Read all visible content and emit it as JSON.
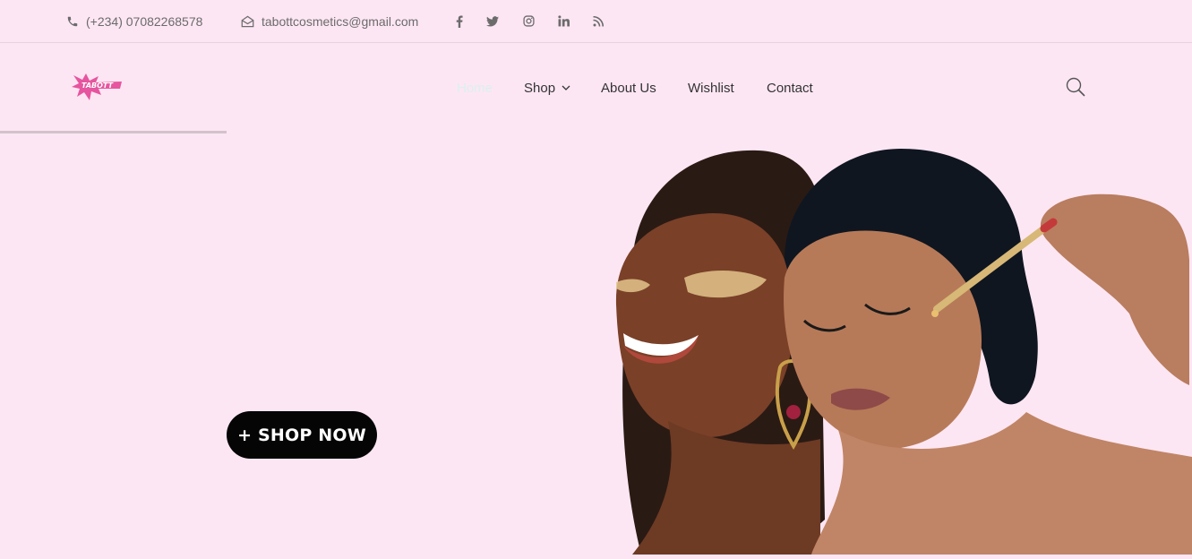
{
  "topbar": {
    "phone": "(+234) 07082268578",
    "email": "tabottcosmetics@gmail.com",
    "social": [
      {
        "icon": "facebook-icon",
        "glyph": "f"
      },
      {
        "icon": "twitter-icon",
        "glyph": "t"
      },
      {
        "icon": "instagram-icon",
        "glyph": "ig"
      },
      {
        "icon": "linkedin-icon",
        "glyph": "in"
      },
      {
        "icon": "rss-icon",
        "glyph": "rss"
      }
    ]
  },
  "logo": {
    "text": "TABOTT"
  },
  "nav": {
    "home": "Home",
    "shop": "Shop",
    "about": "About Us",
    "wishlist": "Wishlist",
    "contact": "Contact"
  },
  "hero": {
    "cta": "+ SHOP NOW"
  },
  "colors": {
    "background": "#fde6f3",
    "accent_home": "#d9f1f1",
    "button": "#050505",
    "logo": "#e6559f"
  }
}
